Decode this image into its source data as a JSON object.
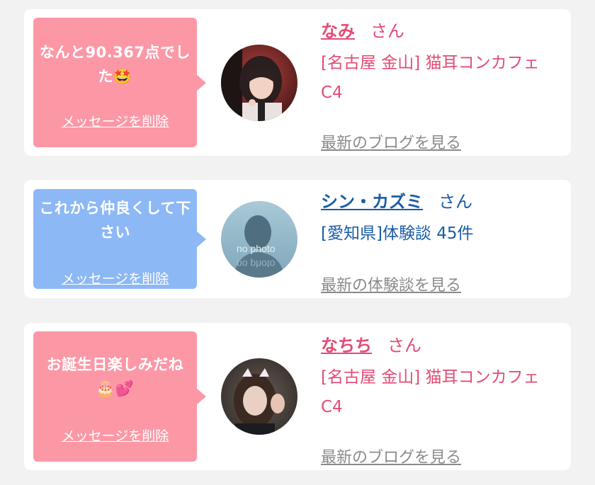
{
  "colors": {
    "card_bg": "#ffffff",
    "page_bg": "#f2f2f2",
    "bubble_pink": "#fc98a6",
    "bubble_blue": "#8db8f6",
    "name_pink": "#e44b74",
    "name_blue": "#1a5ca8",
    "muted_link": "#8a8a8a"
  },
  "delete_label": "メッセージを削除",
  "messages": [
    {
      "bubble_text": "なんと90.367点でした🤩",
      "bubble_color": "pink",
      "avatar_icon": "profile-photo",
      "name": "なみ",
      "honorific": "さん",
      "shop": "[名古屋 金山] 猫耳コンカフェ C4",
      "more_link": "最新のブログを見る"
    },
    {
      "bubble_text": "これから仲良くして下さい",
      "bubble_color": "blue",
      "avatar_icon": "no-photo-silhouette",
      "avatar_text": "no photo",
      "name": "シン・カズミ",
      "honorific": "さん",
      "shop": "[愛知県]体験談 45件",
      "more_link": "最新の体験談を見る"
    },
    {
      "bubble_text": "お誕生日楽しみだね🎂💕",
      "bubble_color": "pink",
      "avatar_icon": "profile-photo",
      "name": "なちち",
      "honorific": "さん",
      "shop": "[名古屋 金山] 猫耳コンカフェ C4",
      "more_link": "最新のブログを見る"
    }
  ]
}
